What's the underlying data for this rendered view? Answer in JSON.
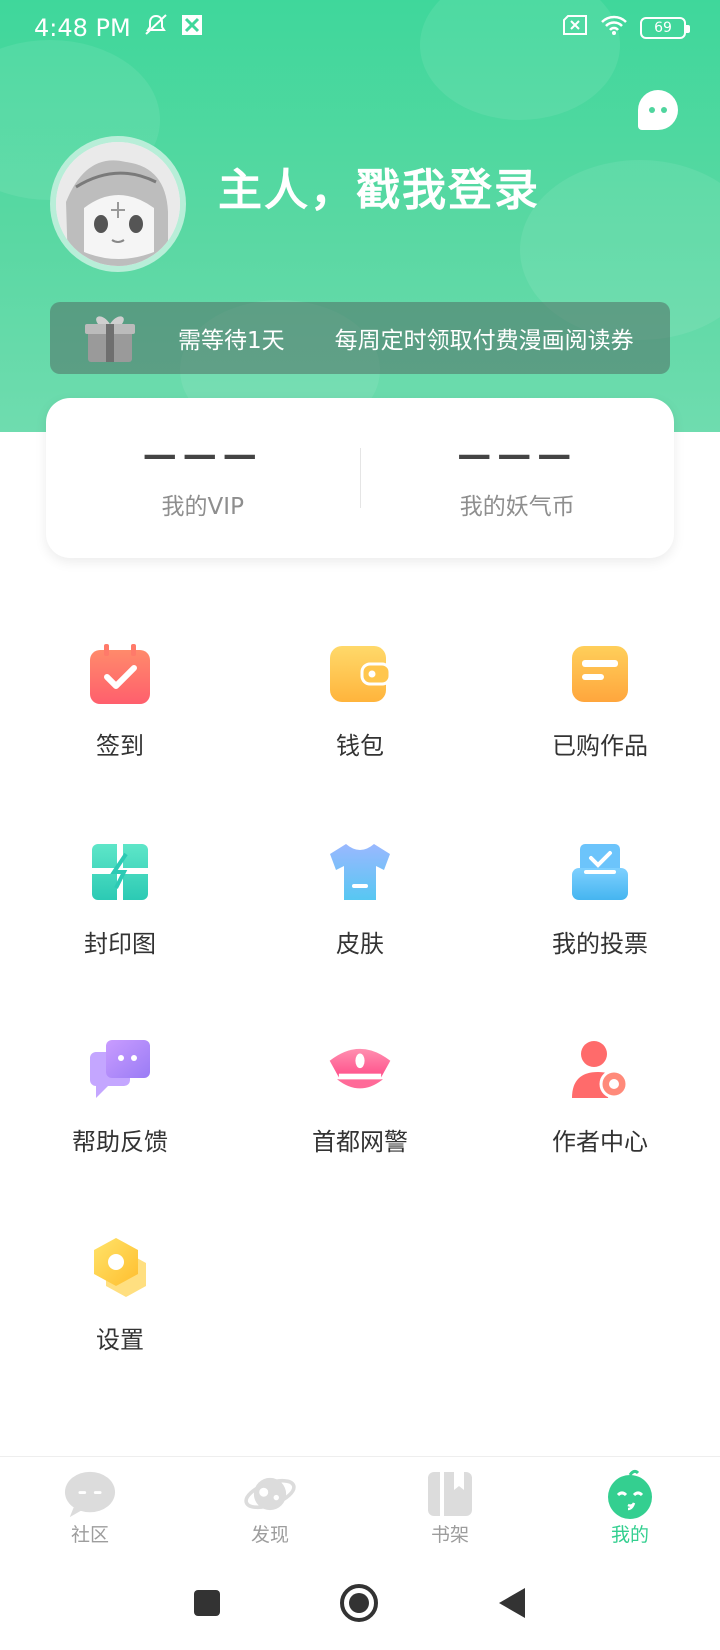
{
  "status": {
    "time": "4:48 PM",
    "battery": "69"
  },
  "header": {
    "login_text": "主人，戳我登录",
    "coupon_wait": "需等待1天",
    "coupon_desc": "每周定时领取付费漫画阅读券"
  },
  "stats": [
    {
      "value": "———",
      "label": "我的VIP"
    },
    {
      "value": "———",
      "label": "我的妖气币"
    }
  ],
  "menu": [
    {
      "label": "签到",
      "icon": "calendar-check-icon"
    },
    {
      "label": "钱包",
      "icon": "wallet-icon"
    },
    {
      "label": "已购作品",
      "icon": "purchased-icon"
    },
    {
      "label": "封印图",
      "icon": "seal-image-icon"
    },
    {
      "label": "皮肤",
      "icon": "tshirt-icon"
    },
    {
      "label": "我的投票",
      "icon": "ballot-box-icon"
    },
    {
      "label": "帮助反馈",
      "icon": "feedback-chat-icon"
    },
    {
      "label": "首都网警",
      "icon": "police-cap-icon"
    },
    {
      "label": "作者中心",
      "icon": "author-icon"
    },
    {
      "label": "设置",
      "icon": "settings-hexagon-icon"
    }
  ],
  "tabs": [
    {
      "label": "社区",
      "active": false
    },
    {
      "label": "发现",
      "active": false
    },
    {
      "label": "书架",
      "active": false
    },
    {
      "label": "我的",
      "active": true
    }
  ],
  "colors": {
    "accent": "#34cf90",
    "header_top": "#3fd79b"
  }
}
